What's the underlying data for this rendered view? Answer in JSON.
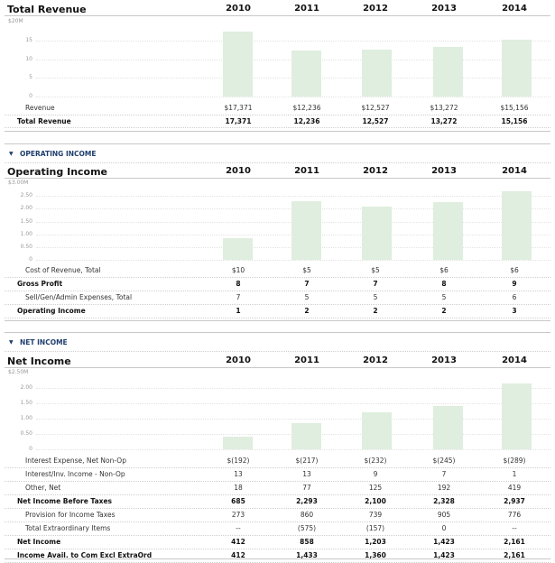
{
  "sections": [
    {
      "title": "Total Revenue",
      "header": null,
      "years": [
        "2010",
        "2011",
        "2012",
        "2013",
        "2014"
      ],
      "axis_ticks": [
        "$20M",
        "15",
        "10",
        "5",
        "0"
      ],
      "bar_values": [
        17371,
        12236,
        12527,
        13272,
        15156
      ],
      "axis_max": 20000,
      "rows": [
        {
          "label": "Revenue",
          "bold": false,
          "indent": 1,
          "values": [
            "$17,371",
            "$12,236",
            "$12,527",
            "$13,272",
            "$15,156"
          ]
        },
        {
          "label": "Total Revenue",
          "bold": true,
          "indent": 0,
          "values": [
            "17,371",
            "12,236",
            "12,527",
            "13,272",
            "15,156"
          ]
        }
      ]
    },
    {
      "title": "Operating Income",
      "header": "OPERATING INCOME",
      "years": [
        "2010",
        "2011",
        "2012",
        "2013",
        "2014"
      ],
      "axis_ticks": [
        "$3.00M",
        "2.50",
        "2.00",
        "1.50",
        "1.00",
        "0.50",
        "0"
      ],
      "bar_values": [
        0.85,
        2.3,
        2.1,
        2.25,
        2.7
      ],
      "axis_max": 3.0,
      "rows": [
        {
          "label": "Cost of Revenue, Total",
          "bold": false,
          "indent": 1,
          "values": [
            "$10",
            "$5",
            "$5",
            "$6",
            "$6"
          ]
        },
        {
          "label": "Gross Profit",
          "bold": true,
          "indent": 0,
          "values": [
            "8",
            "7",
            "7",
            "8",
            "9"
          ]
        },
        {
          "label": "Sell/Gen/Admin Expenses, Total",
          "bold": false,
          "indent": 1,
          "values": [
            "7",
            "5",
            "5",
            "5",
            "6"
          ]
        },
        {
          "label": "Operating Income",
          "bold": true,
          "indent": 0,
          "values": [
            "1",
            "2",
            "2",
            "2",
            "3"
          ]
        }
      ]
    },
    {
      "title": "Net Income",
      "header": "NET INCOME",
      "years": [
        "2010",
        "2011",
        "2012",
        "2013",
        "2014"
      ],
      "axis_ticks": [
        "$2.50M",
        "2.00",
        "1.50",
        "1.00",
        "0.50",
        "0"
      ],
      "bar_values": [
        0.412,
        0.858,
        1.203,
        1.423,
        2.161
      ],
      "axis_max": 2.5,
      "rows": [
        {
          "label": "Interest Expense, Net Non-Op",
          "bold": false,
          "indent": 1,
          "values": [
            "$(192)",
            "$(217)",
            "$(232)",
            "$(245)",
            "$(289)"
          ]
        },
        {
          "label": "Interest/Inv. Income - Non-Op",
          "bold": false,
          "indent": 1,
          "values": [
            "13",
            "13",
            "9",
            "7",
            "1"
          ]
        },
        {
          "label": "Other, Net",
          "bold": false,
          "indent": 1,
          "values": [
            "18",
            "77",
            "125",
            "192",
            "419"
          ]
        },
        {
          "label": "Net Income Before Taxes",
          "bold": true,
          "indent": 0,
          "values": [
            "685",
            "2,293",
            "2,100",
            "2,328",
            "2,937"
          ]
        },
        {
          "label": "Provision for Income Taxes",
          "bold": false,
          "indent": 1,
          "values": [
            "273",
            "860",
            "739",
            "905",
            "776"
          ]
        },
        {
          "label": "Total Extraordinary Items",
          "bold": false,
          "indent": 1,
          "values": [
            "--",
            "(575)",
            "(157)",
            "0",
            "--"
          ]
        },
        {
          "label": "Net Income",
          "bold": true,
          "indent": 0,
          "values": [
            "412",
            "858",
            "1,203",
            "1,423",
            "2,161"
          ]
        },
        {
          "label": "Income Avail. to Com Excl ExtraOrd",
          "bold": true,
          "indent": 0,
          "values": [
            "412",
            "1,433",
            "1,360",
            "1,423",
            "2,161"
          ]
        }
      ]
    }
  ]
}
